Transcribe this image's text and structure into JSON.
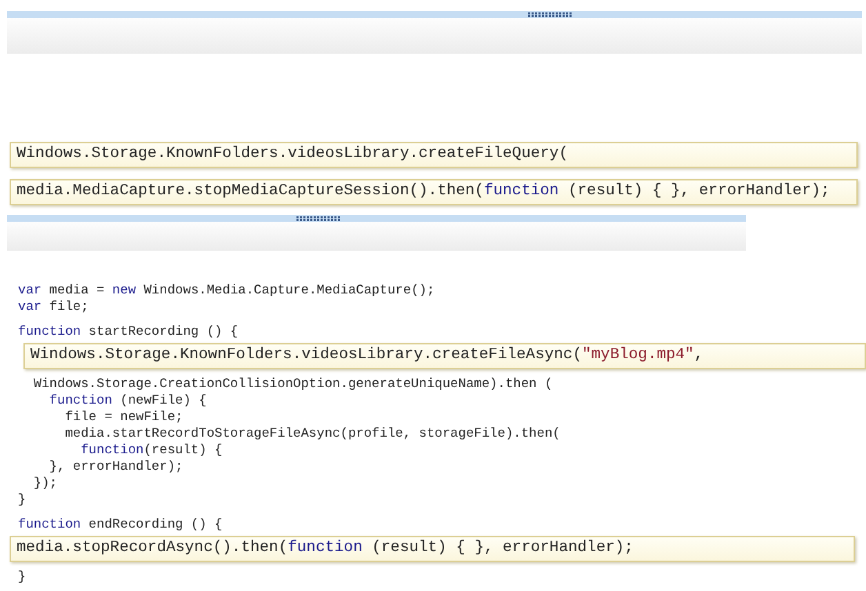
{
  "answer_choices": [
    {
      "segments": [
        {
          "kind": "plain",
          "text": "Windows.Storage.KnownFolders.videosLibrary.createFileQuery("
        }
      ]
    },
    {
      "segments": [
        {
          "kind": "plain",
          "text": "media.MediaCapture.stopMediaCaptureSession().then("
        },
        {
          "kind": "keyword",
          "text": "function"
        },
        {
          "kind": "plain",
          "text": " (result) { }, errorHandler);"
        }
      ]
    }
  ],
  "code_lines": [
    {
      "kind": "code",
      "segments": [
        {
          "kind": "keyword",
          "text": "var"
        },
        {
          "kind": "plain",
          "text": " media = "
        },
        {
          "kind": "keyword",
          "text": "new"
        },
        {
          "kind": "plain",
          "text": " Windows.Media.Capture.MediaCapture();"
        }
      ]
    },
    {
      "kind": "code",
      "segments": [
        {
          "kind": "keyword",
          "text": "var"
        },
        {
          "kind": "plain",
          "text": " file;"
        }
      ]
    },
    {
      "kind": "blank"
    },
    {
      "kind": "code",
      "segments": [
        {
          "kind": "keyword",
          "text": "function"
        },
        {
          "kind": "plain",
          "text": " startRecording () {"
        }
      ]
    },
    {
      "kind": "slot",
      "segments": [
        {
          "kind": "plain",
          "text": "Windows.Storage.KnownFolders.videosLibrary.createFileAsync("
        },
        {
          "kind": "string",
          "text": "\"myBlog.mp4\""
        },
        {
          "kind": "plain",
          "text": ","
        }
      ]
    },
    {
      "kind": "code",
      "segments": [
        {
          "kind": "plain",
          "text": "  Windows.Storage.CreationCollisionOption.generateUniqueName).then ("
        }
      ]
    },
    {
      "kind": "code",
      "segments": [
        {
          "kind": "keyword",
          "text": "    function"
        },
        {
          "kind": "plain",
          "text": " (newFile) {"
        }
      ]
    },
    {
      "kind": "code",
      "segments": [
        {
          "kind": "plain",
          "text": "      file = newFile;"
        }
      ]
    },
    {
      "kind": "code",
      "segments": [
        {
          "kind": "plain",
          "text": "      media.startRecordToStorageFileAsync(profile, storageFile).then("
        }
      ]
    },
    {
      "kind": "code",
      "segments": [
        {
          "kind": "keyword",
          "text": "        function"
        },
        {
          "kind": "plain",
          "text": "(result) {"
        }
      ]
    },
    {
      "kind": "code",
      "segments": [
        {
          "kind": "plain",
          "text": "    }, errorHandler);"
        }
      ]
    },
    {
      "kind": "code",
      "segments": [
        {
          "kind": "plain",
          "text": "  });"
        }
      ]
    },
    {
      "kind": "code",
      "segments": [
        {
          "kind": "plain",
          "text": "}"
        }
      ]
    },
    {
      "kind": "blank"
    },
    {
      "kind": "code",
      "segments": [
        {
          "kind": "keyword",
          "text": "function"
        },
        {
          "kind": "plain",
          "text": " endRecording () {"
        }
      ]
    },
    {
      "kind": "slot",
      "segments": [
        {
          "kind": "plain",
          "text": "media.stopRecordAsync().then("
        },
        {
          "kind": "keyword",
          "text": "function"
        },
        {
          "kind": "plain",
          "text": " (result) { }, errorHandler);"
        }
      ]
    },
    {
      "kind": "code",
      "segments": [
        {
          "kind": "plain",
          "text": "}"
        }
      ]
    }
  ]
}
